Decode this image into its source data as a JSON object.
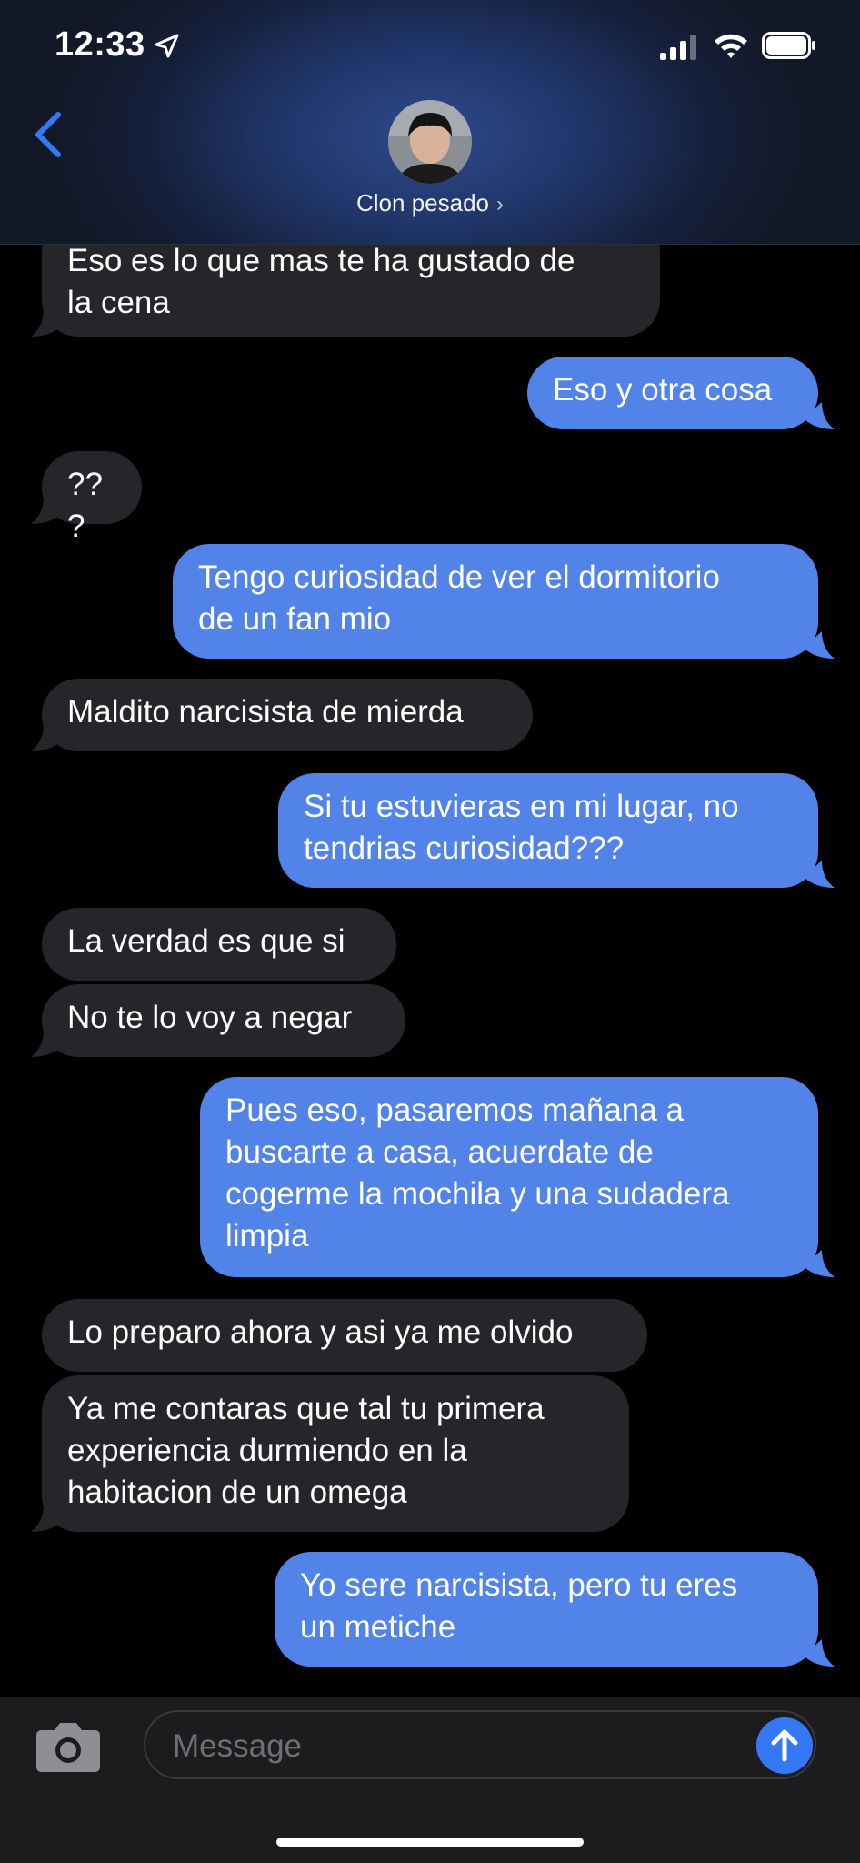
{
  "status_bar": {
    "time": "12:33"
  },
  "header": {
    "contact_name": "Clon pesado",
    "chevron": "›"
  },
  "messages": [
    {
      "direction": "incoming",
      "text": "Eso es lo que mas te ha gustado de\nla cena"
    },
    {
      "direction": "outgoing",
      "text": "Eso y otra cosa"
    },
    {
      "direction": "incoming",
      "text": "???"
    },
    {
      "direction": "outgoing",
      "text": "Tengo curiosidad de ver el dormitorio\nde un fan mio"
    },
    {
      "direction": "incoming",
      "text": "Maldito narcisista de mierda"
    },
    {
      "direction": "outgoing",
      "text": "Si tu estuvieras en mi lugar, no\ntendrias curiosidad???"
    },
    {
      "direction": "incoming",
      "text": "La verdad es que si"
    },
    {
      "direction": "incoming",
      "text": "No te lo voy a negar"
    },
    {
      "direction": "outgoing",
      "text": "Pues eso, pasaremos mañana a\nbuscarte a casa, acuerdate de\ncogerme la mochila y una sudadera\nlimpia"
    },
    {
      "direction": "incoming",
      "text": "Lo preparo ahora y asi ya me olvido"
    },
    {
      "direction": "incoming",
      "text": "Ya me contaras que tal tu primera\nexperiencia durmiendo en la\nhabitacion de un omega"
    },
    {
      "direction": "outgoing",
      "text": "Yo sere narcisista, pero tu eres\nun metiche"
    }
  ],
  "composer": {
    "placeholder": "Message"
  },
  "colors": {
    "outgoing_bubble": "#5183e8",
    "incoming_bubble": "#26252a",
    "accent": "#3478f6"
  },
  "icons": {
    "back": "chevron-left-icon",
    "location": "location-arrow-icon",
    "signal": "cellular-signal-icon",
    "wifi": "wifi-icon",
    "battery": "battery-icon",
    "camera": "camera-icon",
    "send": "arrow-up-icon"
  }
}
